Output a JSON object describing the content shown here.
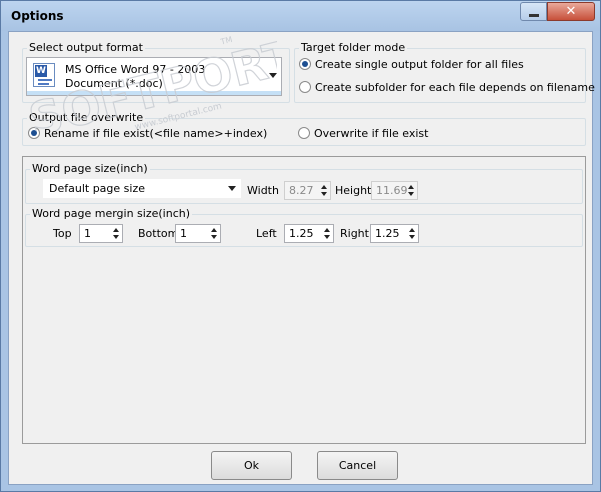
{
  "window": {
    "title": "Options",
    "close_glyph": "✕"
  },
  "output_format": {
    "label": "Select output format",
    "selected": "MS Office Word 97 - 2003 Document (*.doc)",
    "icon": "word-doc-icon"
  },
  "target_folder": {
    "label": "Target folder mode",
    "options": [
      {
        "label": "Create single output folder for all files",
        "selected": true
      },
      {
        "label": "Create subfolder for each file depends on filename",
        "selected": false
      }
    ]
  },
  "overwrite": {
    "label": "Output file overwrite",
    "options": [
      {
        "label": "Rename if file exist(<file name>+index)",
        "selected": true
      },
      {
        "label": "Overwrite if file exist",
        "selected": false
      }
    ]
  },
  "page_size": {
    "label": "Word page size(inch)",
    "size_value": "Default page size",
    "width_label": "Width",
    "width_value": "8.27",
    "height_label": "Height",
    "height_value": "11.69"
  },
  "margin": {
    "label": "Word page mergin size(inch)",
    "top_label": "Top",
    "top_value": "1",
    "bottom_label": "Bottom",
    "bottom_value": "1",
    "left_label": "Left",
    "left_value": "1.25",
    "right_label": "Right",
    "right_value": "1.25"
  },
  "buttons": {
    "ok": "Ok",
    "cancel": "Cancel"
  },
  "watermark": {
    "text": "SOFTPORTAL",
    "tm": "TM",
    "url": "www.softportal.com"
  }
}
